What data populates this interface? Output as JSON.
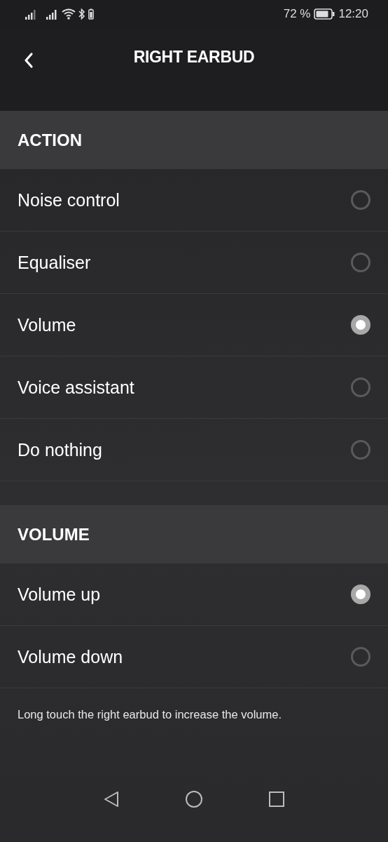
{
  "status_bar": {
    "battery_percent": "72 %",
    "time": "12:20"
  },
  "header": {
    "title": "RIGHT EARBUD"
  },
  "sections": [
    {
      "title": "ACTION",
      "options": [
        {
          "label": "Noise control",
          "selected": false
        },
        {
          "label": "Equaliser",
          "selected": false
        },
        {
          "label": "Volume",
          "selected": true
        },
        {
          "label": "Voice assistant",
          "selected": false
        },
        {
          "label": "Do nothing",
          "selected": false
        }
      ]
    },
    {
      "title": "VOLUME",
      "options": [
        {
          "label": "Volume up",
          "selected": true
        },
        {
          "label": "Volume down",
          "selected": false
        }
      ],
      "note": "Long touch the right earbud to increase the volume."
    }
  ]
}
